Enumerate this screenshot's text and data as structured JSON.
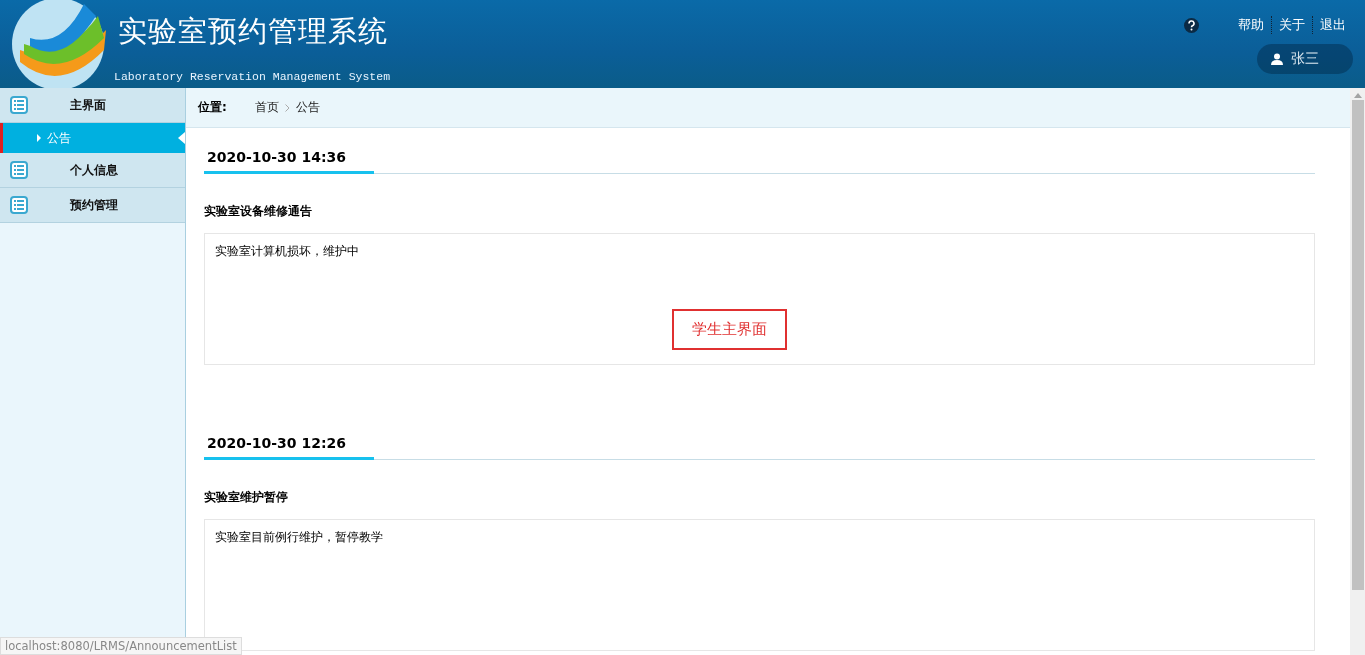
{
  "header": {
    "title": "实验室预约管理系统",
    "subtitle": "Laboratory Reservation Management System",
    "links": [
      "帮助",
      "关于",
      "退出"
    ],
    "user": "张三"
  },
  "sidebar": {
    "items": [
      {
        "label": "主界面",
        "children": [
          {
            "label": "公告",
            "selected": true
          }
        ]
      },
      {
        "label": "个人信息"
      },
      {
        "label": "预约管理"
      }
    ]
  },
  "breadcrumb": {
    "label": "位置:",
    "path": [
      "首页",
      "公告"
    ]
  },
  "announcements": [
    {
      "time": "2020-10-30 14:36",
      "title": "实验室设备维修通告",
      "body": "实验室计算机损坏，维护中"
    },
    {
      "time": "2020-10-30 12:26",
      "title": "实验室维护暂停",
      "body": "实验室目前例行维护，暂停教学"
    }
  ],
  "annotation": "学生主界面",
  "status_url": "localhost:8080/LRMS/AnnouncementList"
}
